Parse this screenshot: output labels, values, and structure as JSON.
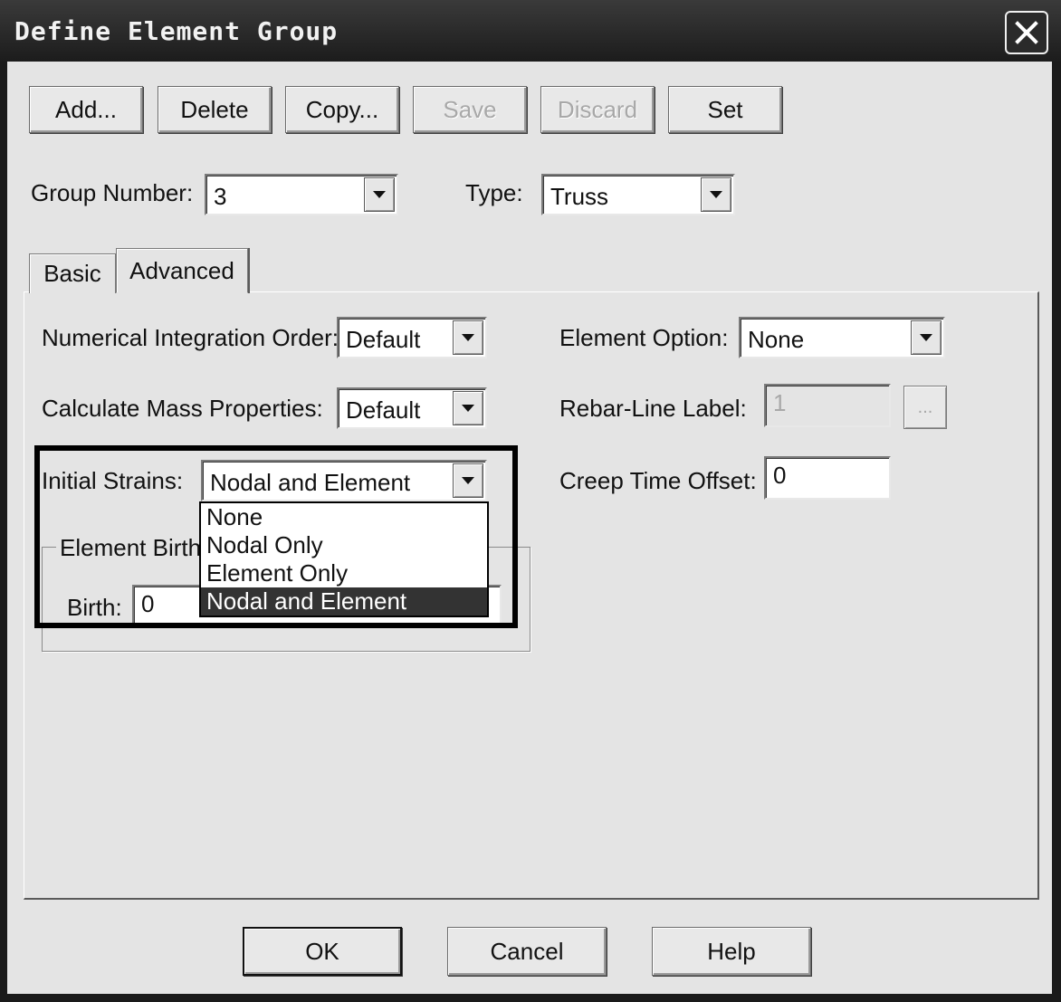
{
  "window": {
    "title": "Define Element Group"
  },
  "toolbar": {
    "add_label": "Add...",
    "delete_label": "Delete",
    "copy_label": "Copy...",
    "save_label": "Save",
    "discard_label": "Discard",
    "set_label": "Set"
  },
  "header": {
    "group_number_label": "Group Number:",
    "group_number_value": "3",
    "type_label": "Type:",
    "type_value": "Truss"
  },
  "tabs": [
    {
      "label": "Basic",
      "active": false
    },
    {
      "label": "Advanced",
      "active": true
    }
  ],
  "advanced": {
    "integration_order_label": "Numerical Integration Order:",
    "integration_order_value": "Default",
    "mass_properties_label": "Calculate Mass Properties:",
    "mass_properties_value": "Default",
    "initial_strains_label": "Initial Strains:",
    "initial_strains_value": "Nodal and Element",
    "initial_strains_options": [
      "None",
      "Nodal Only",
      "Element Only",
      "Nodal and Element"
    ],
    "element_option_label": "Element Option:",
    "element_option_value": "None",
    "rebar_label": "Rebar-Line Label:",
    "rebar_value": "1",
    "rebar_browse_label": "...",
    "creep_label": "Creep Time Offset:",
    "creep_value": "0",
    "birth_group_legend": "Element Birth/",
    "birth_label": "Birth:",
    "birth_value": "0"
  },
  "footer": {
    "ok_label": "OK",
    "cancel_label": "Cancel",
    "help_label": "Help"
  }
}
